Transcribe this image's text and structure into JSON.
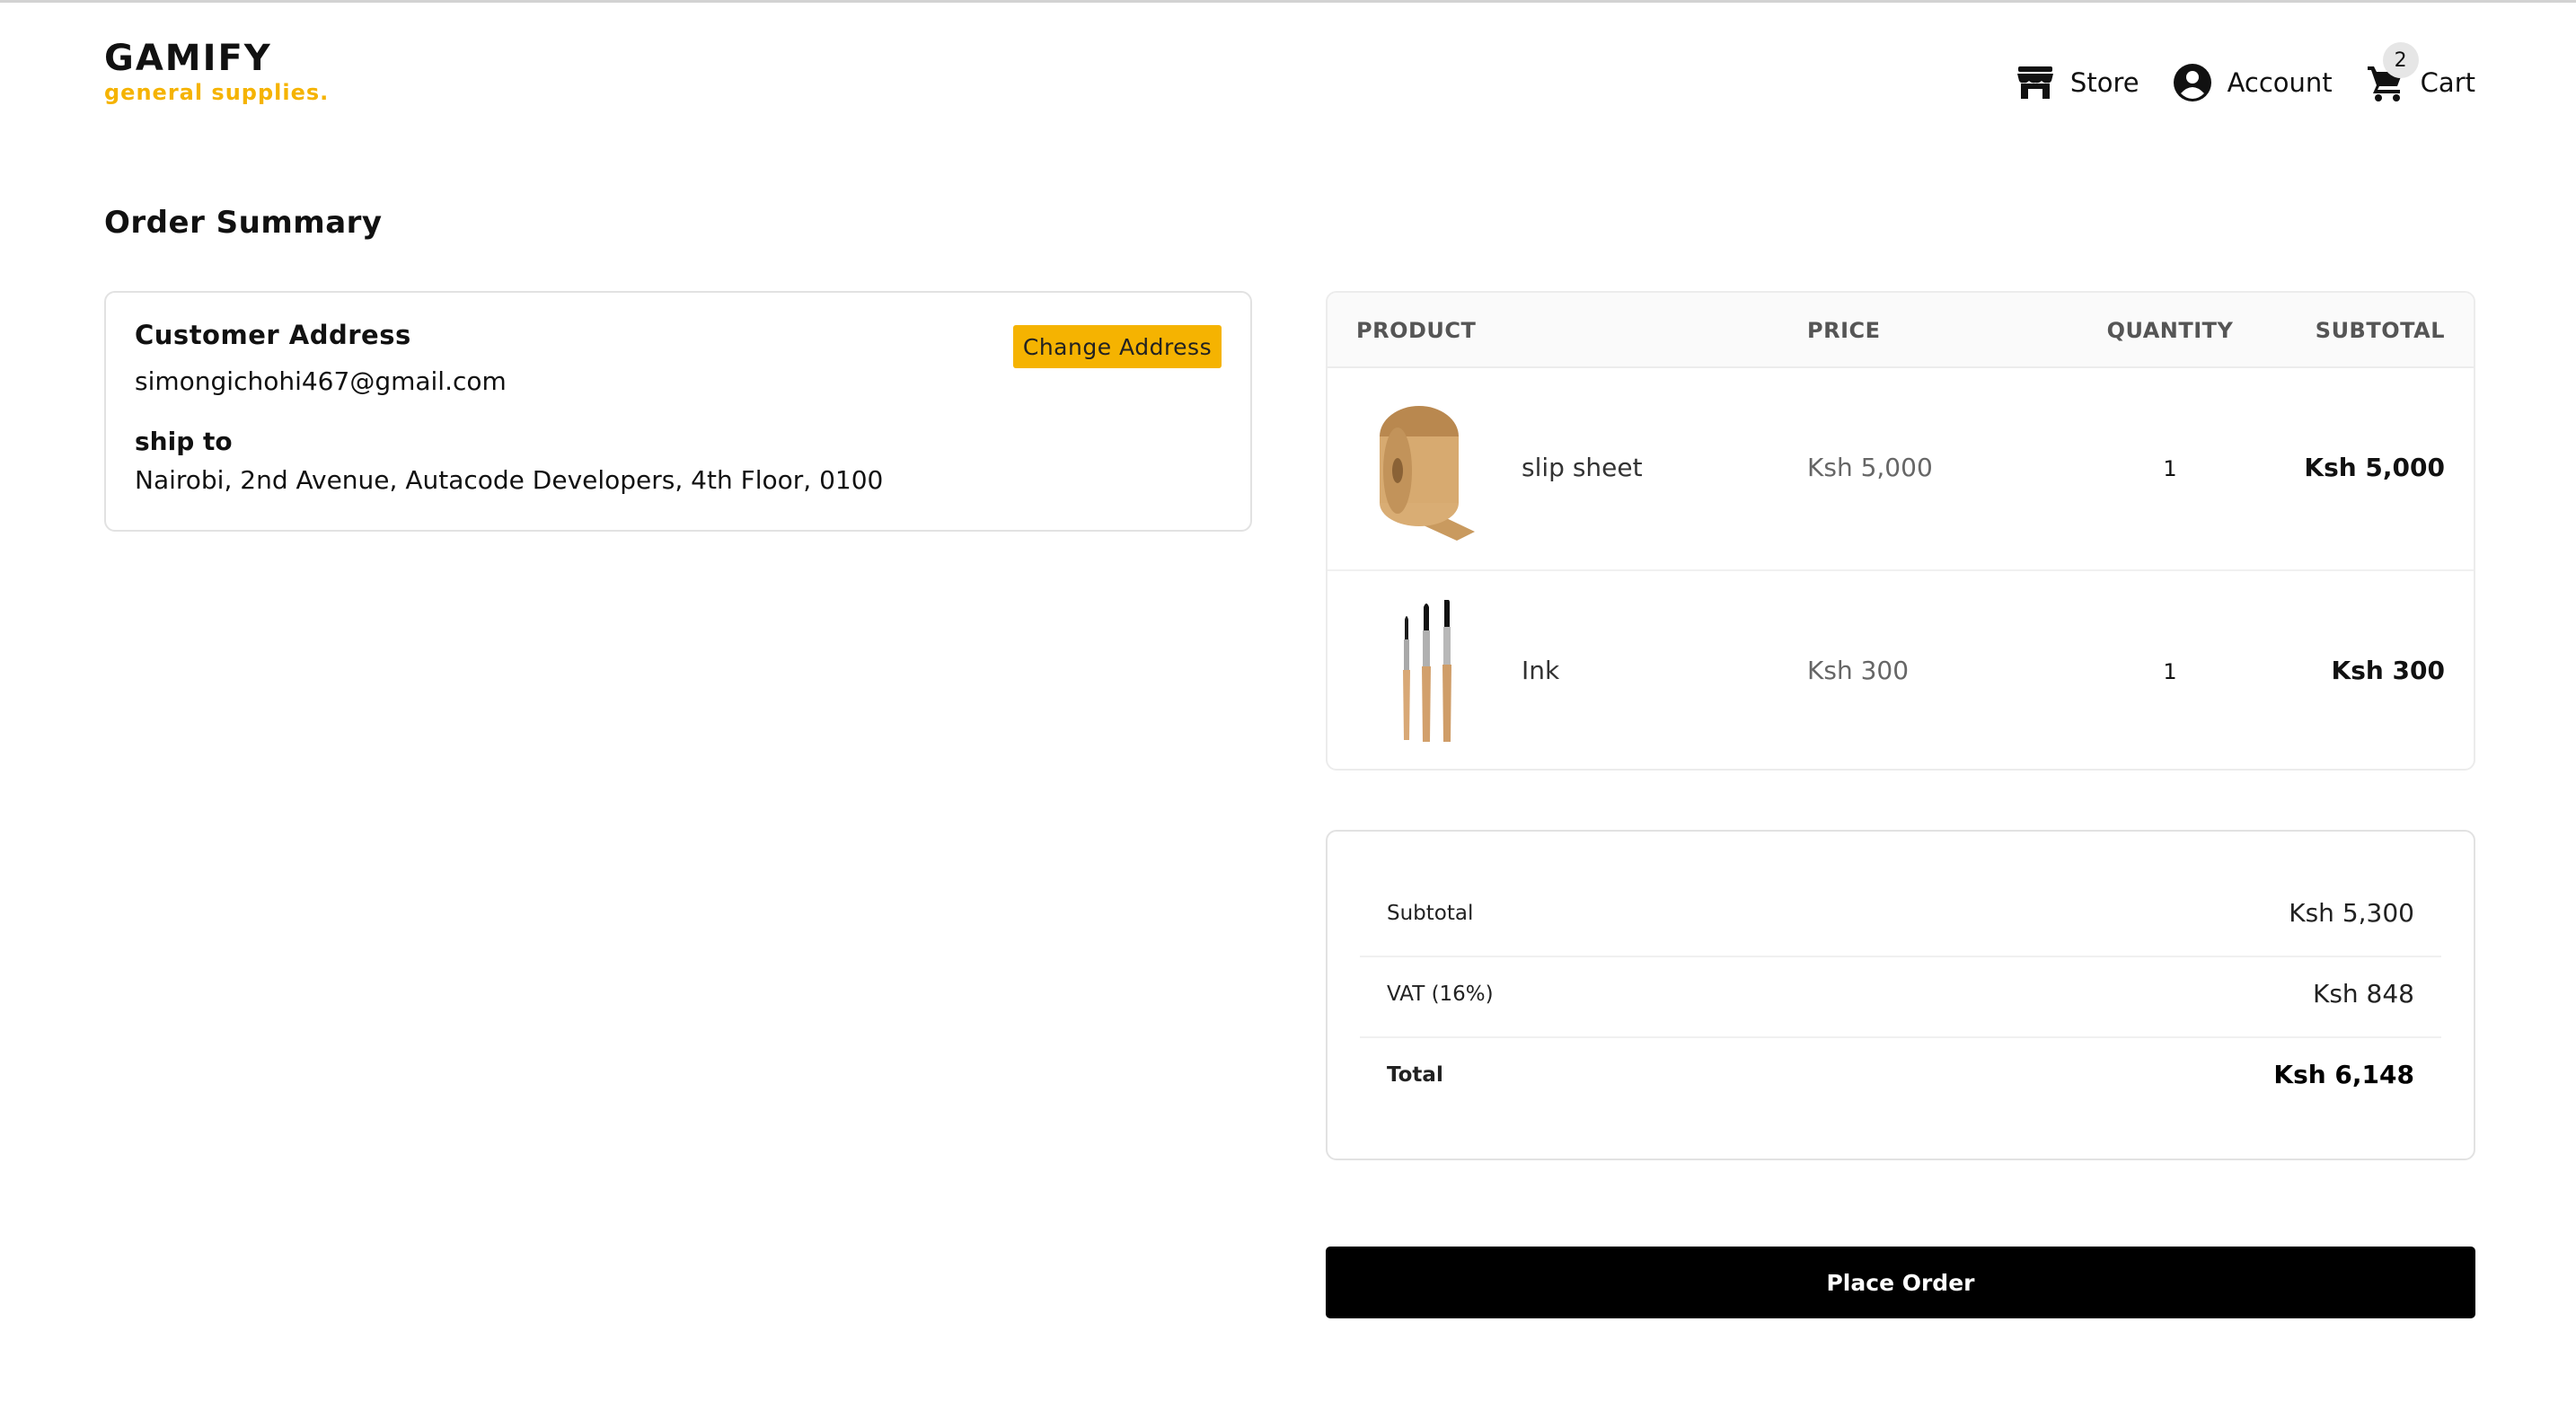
{
  "brand": {
    "name": "GAMIFY",
    "tagline": "general supplies."
  },
  "nav": {
    "store_label": "Store",
    "account_label": "Account",
    "cart_label": "Cart",
    "cart_count": "2"
  },
  "page": {
    "title": "Order Summary"
  },
  "address": {
    "heading": "Customer Address",
    "email": "simongichohi467@gmail.com",
    "ship_to_label": "ship to",
    "ship_to": "Nairobi, 2nd Avenue, Autacode Developers, 4th Floor, 0100",
    "change_label": "Change Address"
  },
  "products": {
    "headers": {
      "product": "PRODUCT",
      "price": "PRICE",
      "quantity": "QUANTITY",
      "subtotal": "SUBTOTAL"
    },
    "items": [
      {
        "name": "slip sheet",
        "price": "Ksh 5,000",
        "quantity": "1",
        "subtotal": "Ksh 5,000",
        "image": "kraft-paper-roll"
      },
      {
        "name": "Ink",
        "price": "Ksh 300",
        "quantity": "1",
        "subtotal": "Ksh 300",
        "image": "paint-brushes"
      }
    ]
  },
  "totals": {
    "subtotal_label": "Subtotal",
    "subtotal_value": "Ksh 5,300",
    "vat_label": "VAT (16%)",
    "vat_value": "Ksh 848",
    "total_label": "Total",
    "total_value": "Ksh 6,148"
  },
  "actions": {
    "place_order_label": "Place Order"
  },
  "colors": {
    "accent": "#f5b301",
    "primary_button": "#000000"
  }
}
